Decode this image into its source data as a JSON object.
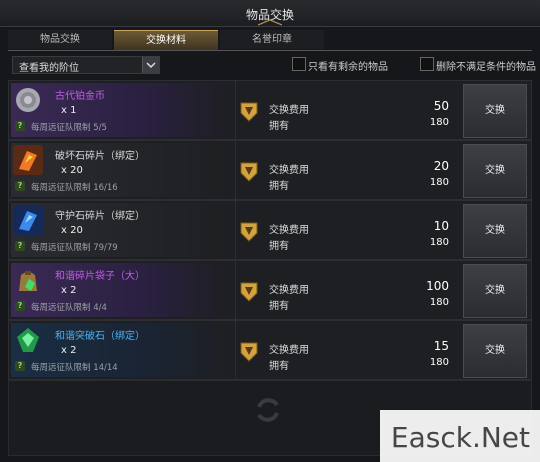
{
  "window": {
    "title": "物品交换"
  },
  "tabs": [
    {
      "label": "物品交换",
      "active": false
    },
    {
      "label": "交换材料",
      "active": true
    },
    {
      "label": "名誉印章",
      "active": false
    }
  ],
  "filter": {
    "dropdown_label": "查看我的阶位",
    "check1_label": "只看有剩余的物品",
    "check2_label": "删除不满足条件的物品"
  },
  "labels": {
    "cost": "交换费用",
    "own": "拥有",
    "exchange_button": "交换"
  },
  "items": [
    {
      "name": "古代铂金币",
      "name_color": "#c35be8",
      "icon": "coin-icon",
      "qty": "x 1",
      "weekly": "每周远征队限制 5/5",
      "cost": "50",
      "own": "180"
    },
    {
      "name": "破坏石碎片（绑定）",
      "name_color": "#e6e6e6",
      "icon": "fire-shard-icon",
      "qty": "x 20",
      "weekly": "每周远征队限制 16/16",
      "cost": "20",
      "own": "180"
    },
    {
      "name": "守护石碎片（绑定）",
      "name_color": "#e6e6e6",
      "icon": "blue-shard-icon",
      "qty": "x 20",
      "weekly": "每周远征队限制 79/79",
      "cost": "10",
      "own": "180"
    },
    {
      "name": "和谐碎片袋子（大）",
      "name_color": "#c35be8",
      "icon": "bag-icon",
      "qty": "x 2",
      "weekly": "每周远征队限制 4/4",
      "cost": "100",
      "own": "180"
    },
    {
      "name": "和谐突破石（绑定）",
      "name_color": "#4ab0f0",
      "icon": "green-stone-icon",
      "qty": "x 2",
      "weekly": "每周远征队限制 14/14",
      "cost": "15",
      "own": "180"
    }
  ],
  "watermark": {
    "text": "Easck.Net"
  }
}
